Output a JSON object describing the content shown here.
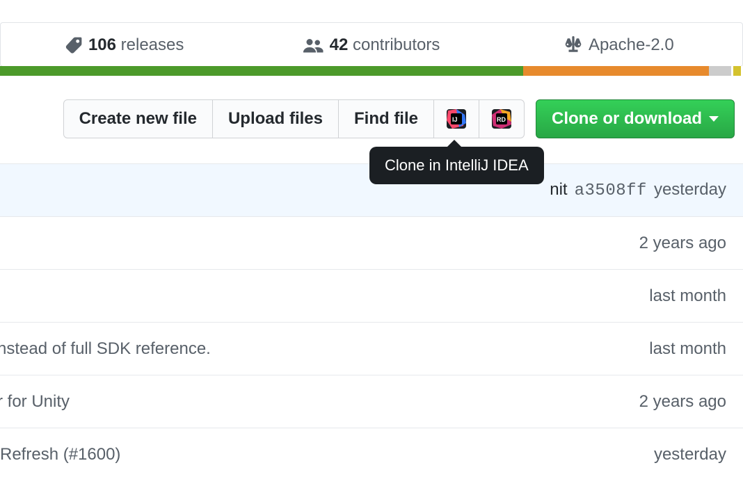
{
  "meta": {
    "releases_count": "106",
    "releases_label": "releases",
    "contributors_count": "42",
    "contributors_label": "contributors",
    "license_label": "Apache-2.0"
  },
  "toolbar": {
    "create_file": "Create new file",
    "upload_files": "Upload files",
    "find_file": "Find file",
    "clone_download": "Clone or download",
    "tooltip_intellij": "Clone in IntelliJ IDEA"
  },
  "commit_line": {
    "prefix": "nit",
    "sha": "a3508ff",
    "age": "yesterday"
  },
  "rows": [
    {
      "message": "",
      "age": "2 years ago"
    },
    {
      "message": "",
      "age": "last month"
    },
    {
      "message": "nstead of full SDK reference.",
      "age": "last month"
    },
    {
      "message": "r for Unity",
      "age": "2 years ago"
    },
    {
      "message": "Refresh (#1600)",
      "age": "yesterday"
    }
  ]
}
